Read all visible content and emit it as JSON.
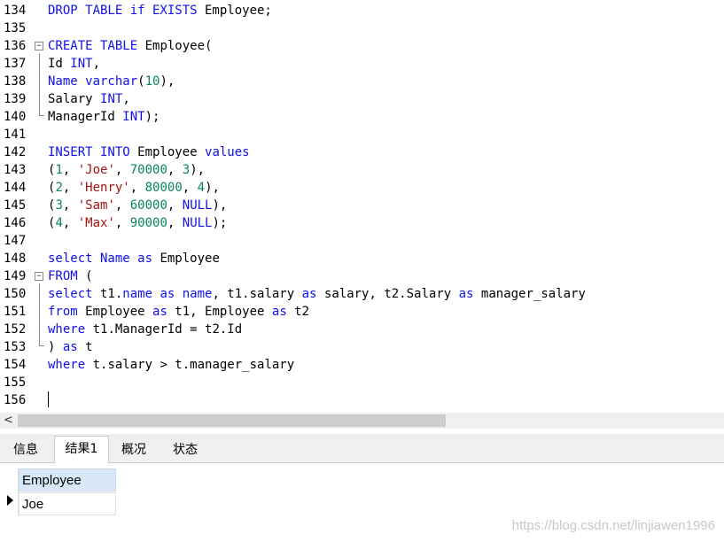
{
  "editor": {
    "lines": [
      {
        "n": "134",
        "tokens": [
          [
            "kw",
            "DROP TABLE if EXISTS"
          ],
          [
            "t",
            " Employee;"
          ]
        ]
      },
      {
        "n": "135",
        "tokens": []
      },
      {
        "n": "136",
        "tokens": [
          [
            "kw",
            "CREATE TABLE"
          ],
          [
            "t",
            " Employee("
          ]
        ]
      },
      {
        "n": "137",
        "tokens": [
          [
            "t",
            "Id "
          ],
          [
            "kw",
            "INT"
          ],
          [
            "t",
            ","
          ]
        ]
      },
      {
        "n": "138",
        "tokens": [
          [
            "kw",
            "Name varchar"
          ],
          [
            "t",
            "("
          ],
          [
            "num",
            "10"
          ],
          [
            "t",
            "),"
          ]
        ]
      },
      {
        "n": "139",
        "tokens": [
          [
            "t",
            "Salary "
          ],
          [
            "kw",
            "INT"
          ],
          [
            "t",
            ","
          ]
        ]
      },
      {
        "n": "140",
        "tokens": [
          [
            "t",
            "ManagerId "
          ],
          [
            "kw",
            "INT"
          ],
          [
            "t",
            ");"
          ]
        ]
      },
      {
        "n": "141",
        "tokens": []
      },
      {
        "n": "142",
        "tokens": [
          [
            "kw",
            "INSERT INTO"
          ],
          [
            "t",
            " Employee "
          ],
          [
            "kw",
            "values"
          ]
        ]
      },
      {
        "n": "143",
        "tokens": [
          [
            "t",
            "("
          ],
          [
            "num",
            "1"
          ],
          [
            "t",
            ", "
          ],
          [
            "str",
            "'Joe'"
          ],
          [
            "t",
            ", "
          ],
          [
            "num",
            "70000"
          ],
          [
            "t",
            ", "
          ],
          [
            "num",
            "3"
          ],
          [
            "t",
            "),"
          ]
        ]
      },
      {
        "n": "144",
        "tokens": [
          [
            "t",
            "("
          ],
          [
            "num",
            "2"
          ],
          [
            "t",
            ", "
          ],
          [
            "str",
            "'Henry'"
          ],
          [
            "t",
            ", "
          ],
          [
            "num",
            "80000"
          ],
          [
            "t",
            ", "
          ],
          [
            "num",
            "4"
          ],
          [
            "t",
            "),"
          ]
        ]
      },
      {
        "n": "145",
        "tokens": [
          [
            "t",
            "("
          ],
          [
            "num",
            "3"
          ],
          [
            "t",
            ", "
          ],
          [
            "str",
            "'Sam'"
          ],
          [
            "t",
            ", "
          ],
          [
            "num",
            "60000"
          ],
          [
            "t",
            ", "
          ],
          [
            "kw",
            "NULL"
          ],
          [
            "t",
            "),"
          ]
        ]
      },
      {
        "n": "146",
        "tokens": [
          [
            "t",
            "("
          ],
          [
            "num",
            "4"
          ],
          [
            "t",
            ", "
          ],
          [
            "str",
            "'Max'"
          ],
          [
            "t",
            ", "
          ],
          [
            "num",
            "90000"
          ],
          [
            "t",
            ", "
          ],
          [
            "kw",
            "NULL"
          ],
          [
            "t",
            ");"
          ]
        ]
      },
      {
        "n": "147",
        "tokens": []
      },
      {
        "n": "148",
        "tokens": [
          [
            "kw",
            "select Name as"
          ],
          [
            "t",
            " Employee"
          ]
        ]
      },
      {
        "n": "149",
        "tokens": [
          [
            "kw",
            "FROM"
          ],
          [
            "t",
            " ("
          ]
        ]
      },
      {
        "n": "150",
        "tokens": [
          [
            "kw",
            "select"
          ],
          [
            "t",
            " t1."
          ],
          [
            "kw",
            "name as name"
          ],
          [
            "t",
            ", t1.salary "
          ],
          [
            "kw",
            "as"
          ],
          [
            "t",
            " salary, t2.Salary "
          ],
          [
            "kw",
            "as"
          ],
          [
            "t",
            " manager_salary"
          ]
        ]
      },
      {
        "n": "151",
        "tokens": [
          [
            "kw",
            "from"
          ],
          [
            "t",
            " Employee "
          ],
          [
            "kw",
            "as"
          ],
          [
            "t",
            " t1, Employee "
          ],
          [
            "kw",
            "as"
          ],
          [
            "t",
            " t2"
          ]
        ]
      },
      {
        "n": "152",
        "tokens": [
          [
            "kw",
            "where"
          ],
          [
            "t",
            " t1.ManagerId = t2.Id"
          ]
        ]
      },
      {
        "n": "153",
        "tokens": [
          [
            "t",
            ") "
          ],
          [
            "kw",
            "as"
          ],
          [
            "t",
            " t"
          ]
        ]
      },
      {
        "n": "154",
        "tokens": [
          [
            "kw",
            "where"
          ],
          [
            "t",
            " t.salary > t.manager_salary"
          ]
        ]
      },
      {
        "n": "155",
        "tokens": []
      },
      {
        "n": "156",
        "tokens": []
      }
    ]
  },
  "scrollbar": {
    "left_arrow": "<"
  },
  "tabs": [
    {
      "label": "信息"
    },
    {
      "label": "结果1"
    },
    {
      "label": "概况"
    },
    {
      "label": "状态"
    }
  ],
  "results": {
    "columns": [
      "Employee"
    ],
    "rows": [
      [
        "Joe"
      ]
    ]
  },
  "watermark": "https://blog.csdn.net/linjiawen1996"
}
